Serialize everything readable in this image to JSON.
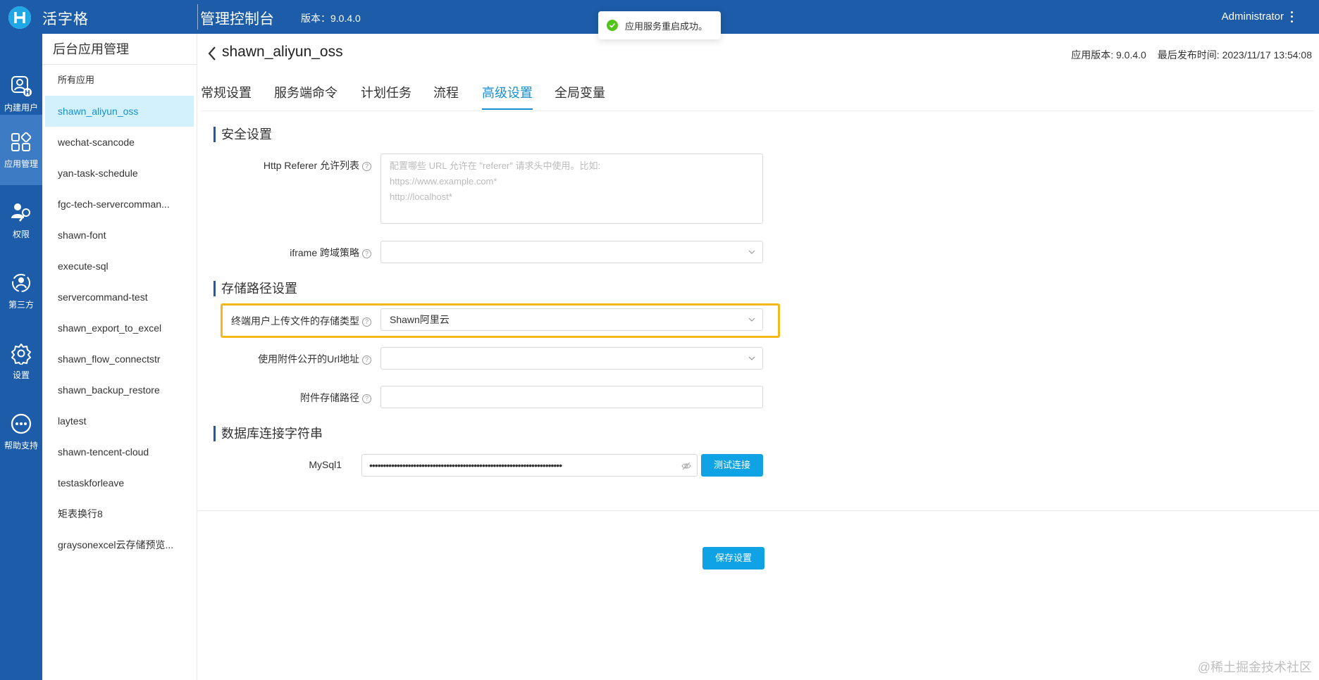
{
  "topbar": {
    "brand": "活字格",
    "console_title": "管理控制台",
    "version": "版本：9.0.4.0",
    "user": "Administrator"
  },
  "toast": {
    "message": "应用服务重启成功。"
  },
  "rail": [
    {
      "label": "内建用户",
      "icon": "user-icon"
    },
    {
      "label": "应用管理",
      "icon": "apps-icon"
    },
    {
      "label": "权限",
      "icon": "permission-icon"
    },
    {
      "label": "第三方",
      "icon": "third-party-icon"
    },
    {
      "label": "设置",
      "icon": "gear-icon"
    },
    {
      "label": "帮助支持",
      "icon": "help-icon"
    }
  ],
  "applist": {
    "title": "后台应用管理",
    "all": "所有应用",
    "items": [
      "shawn_aliyun_oss",
      "wechat-scancode",
      "yan-task-schedule",
      "fgc-tech-servercomman...",
      "shawn-font",
      "execute-sql",
      "servercommand-test",
      "shawn_export_to_excel",
      "shawn_flow_connectstr",
      "shawn_backup_restore",
      "laytest",
      "shawn-tencent-cloud",
      "testaskforleave",
      "矩表换行8",
      "graysonexcel云存储预览..."
    ]
  },
  "main": {
    "app_title": "shawn_aliyun_oss",
    "app_version": "应用版本: 9.0.4.0",
    "publish_time": "最后发布时间: 2023/11/17 13:54:08",
    "tabs": [
      "常规设置",
      "服务端命令",
      "计划任务",
      "流程",
      "高级设置",
      "全局变量"
    ],
    "security": {
      "title": "安全设置",
      "referer_label": "Http Referer 允许列表",
      "referer_placeholder": "配置哪些 URL 允许在 \"referer\" 请求头中使用。比如:\nhttps://www.example.com*\nhttp://localhost*",
      "iframe_label": "iframe 跨域策略",
      "iframe_value": ""
    },
    "storage": {
      "title": "存储路径设置",
      "type_label": "终端用户上传文件的存储类型",
      "type_value": "Shawn阿里云",
      "public_url_label": "使用附件公开的Url地址",
      "public_url_value": "",
      "path_label": "附件存储路径",
      "path_value": ""
    },
    "db": {
      "title": "数据库连接字符串",
      "mysql_label": "MySql1",
      "mysql_value": "••••••••••••••••••••••••••••••••••••••••••••••••••••••••••••••••••••••",
      "test_button": "测试连接"
    },
    "save_button": "保存设置"
  },
  "watermark": "@稀土掘金技术社区",
  "colors": {
    "brand_blue": "#1c5ca8",
    "accent": "#0fa2e4",
    "highlight": "#f5b81a"
  }
}
